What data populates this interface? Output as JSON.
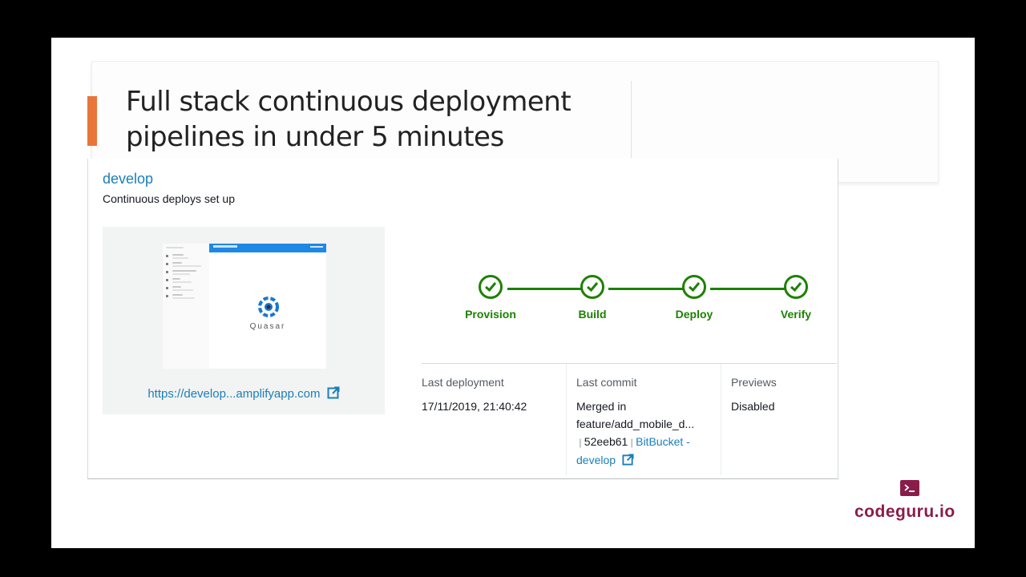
{
  "slide": {
    "title_line1": "Full stack continuous deployment",
    "title_line2": "pipelines in under 5 minutes",
    "accent_color": "#e8763a"
  },
  "app": {
    "branch_name": "develop",
    "status_text": "Continuous deploys set up",
    "preview_app_name": "Quasar",
    "preview_url": "https://develop...amplifyapp.com",
    "pipeline_color": "#1d8102",
    "steps": [
      {
        "label": "Provision",
        "status": "complete",
        "icon": "check-circle-icon"
      },
      {
        "label": "Build",
        "status": "complete",
        "icon": "check-circle-icon"
      },
      {
        "label": "Deploy",
        "status": "complete",
        "icon": "check-circle-icon"
      },
      {
        "label": "Verify",
        "status": "complete",
        "icon": "check-circle-icon"
      }
    ],
    "last_deployment": {
      "label": "Last deployment",
      "value": "17/11/2019, 21:40:42"
    },
    "last_commit": {
      "label": "Last commit",
      "line1": "Merged in",
      "line2": "feature/add_mobile_d...",
      "hash": "52eeb61",
      "repo_link_part1": "BitBucket -",
      "repo_link_part2": "develop"
    },
    "previews": {
      "label": "Previews",
      "value": "Disabled"
    }
  },
  "branding": {
    "name": "codeguru.io",
    "icon": "terminal-icon",
    "color": "#8a1c4a"
  }
}
